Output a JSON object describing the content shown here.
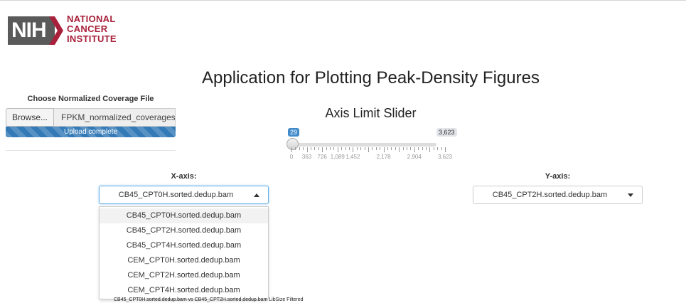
{
  "logo": {
    "nih": "NIH",
    "line1": "NATIONAL",
    "line2": "CANCER",
    "line3": "INSTITUTE"
  },
  "title": "Application for Plotting Peak-Density Figures",
  "upload": {
    "label": "Choose Normalized Coverage File",
    "browse": "Browse...",
    "filename": "FPKM_normalized_coverages.",
    "progress_text": "Upload complete",
    "progress": 1.0
  },
  "slider": {
    "label": "Axis Limit Slider",
    "value": "29",
    "max_label": "3,623",
    "ticks": [
      "0",
      "363",
      "726",
      "1,089",
      "1,452",
      "2,178",
      "2,904",
      "3,623"
    ]
  },
  "x_axis": {
    "label": "X-axis:",
    "selected": "CB45_CPT0H.sorted.dedup.bam",
    "options": [
      "CB45_CPT0H.sorted.dedup.bam",
      "CB45_CPT2H.sorted.dedup.bam",
      "CB45_CPT4H.sorted.dedup.bam",
      "CEM_CPT0H.sorted.dedup.bam",
      "CEM_CPT2H.sorted.dedup.bam",
      "CEM_CPT4H.sorted.dedup.bam"
    ]
  },
  "y_axis": {
    "label": "Y-axis:",
    "selected": "CB45_CPT2H.sorted.dedup.bam"
  },
  "footer_text": "CB45_CPT0H.sorted.dedup.bam vs CB45_CPT2H.sorted.dedup.bam LibSize Filtered",
  "colors": {
    "accent": "#428bca",
    "progress": "#337ab7",
    "nci_red": "#a8203a"
  }
}
